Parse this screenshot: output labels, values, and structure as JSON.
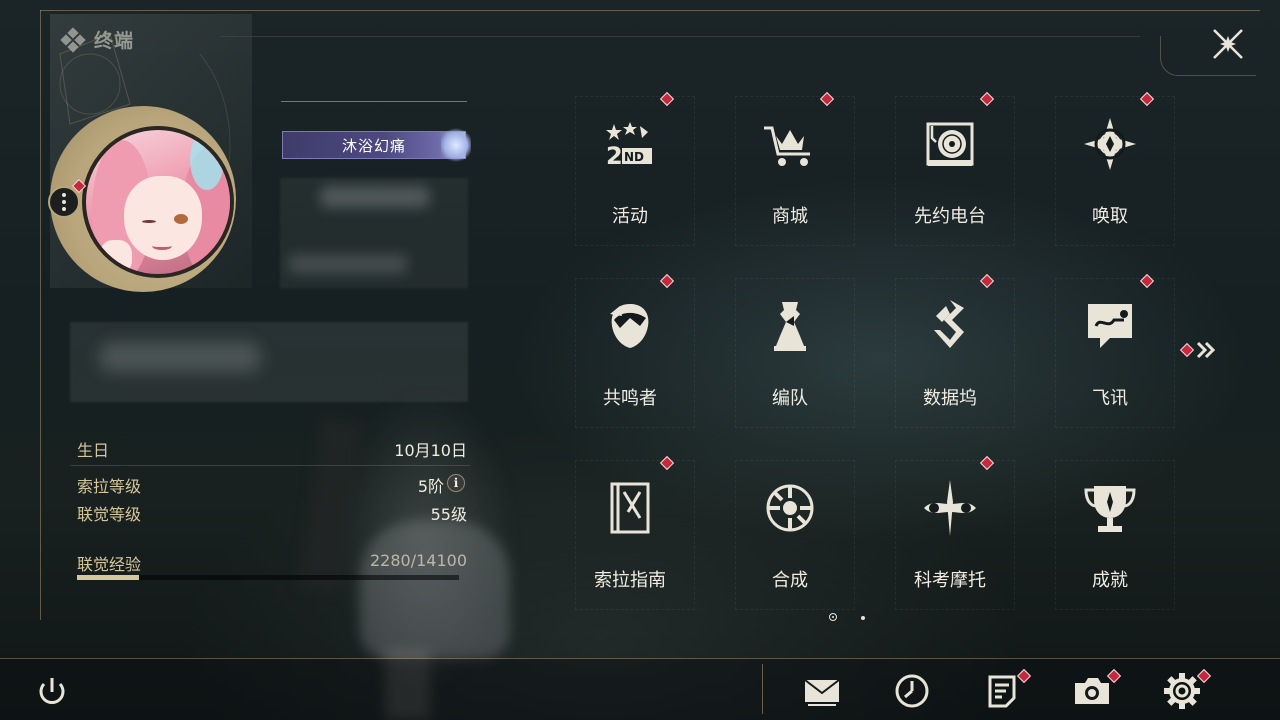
{
  "header": {
    "title": "终端"
  },
  "profile": {
    "badge_title": "沐浴幻痛",
    "stats": [
      {
        "label": "生日",
        "value": "10月10日"
      },
      {
        "label": "索拉等级",
        "value": "5阶"
      },
      {
        "label": "联觉等级",
        "value": "55级"
      },
      {
        "label": "联觉经验",
        "value": "2280/14100"
      }
    ],
    "exp_progress": 0.1617
  },
  "menu": {
    "items": [
      {
        "label": "活动",
        "icon": "event-2nd-anniversary-icon",
        "badge": true
      },
      {
        "label": "商城",
        "icon": "shop-crown-cart-icon",
        "badge": true
      },
      {
        "label": "先约电台",
        "icon": "radio-record-player-icon",
        "badge": true
      },
      {
        "label": "唤取",
        "icon": "convene-compass-icon",
        "badge": true
      },
      {
        "label": "共鸣者",
        "icon": "resonator-portrait-icon",
        "badge": true
      },
      {
        "label": "编队",
        "icon": "team-chess-icon",
        "badge": false
      },
      {
        "label": "数据坞",
        "icon": "data-bank-icon",
        "badge": true
      },
      {
        "label": "飞讯",
        "icon": "messenger-chat-icon",
        "badge": true
      },
      {
        "label": "索拉指南",
        "icon": "guidebook-icon",
        "badge": true
      },
      {
        "label": "合成",
        "icon": "synthesis-icon",
        "badge": false
      },
      {
        "label": "科考摩托",
        "icon": "motorbike-icon",
        "badge": true
      },
      {
        "label": "成就",
        "icon": "achievement-trophy-icon",
        "badge": false
      }
    ],
    "pages": 2,
    "current_page": 1
  },
  "bottom_bar": {
    "buttons": [
      {
        "icon": "power-icon",
        "badge": false
      },
      {
        "icon": "mail-icon",
        "badge": false
      },
      {
        "icon": "clock-icon",
        "badge": false
      },
      {
        "icon": "notice-icon",
        "badge": true
      },
      {
        "icon": "camera-icon",
        "badge": true
      },
      {
        "icon": "settings-gear-icon",
        "badge": true
      }
    ]
  },
  "colors": {
    "accent_gold": "#d4c79e",
    "badge_red": "#c8283c",
    "text": "#f0ece2"
  }
}
